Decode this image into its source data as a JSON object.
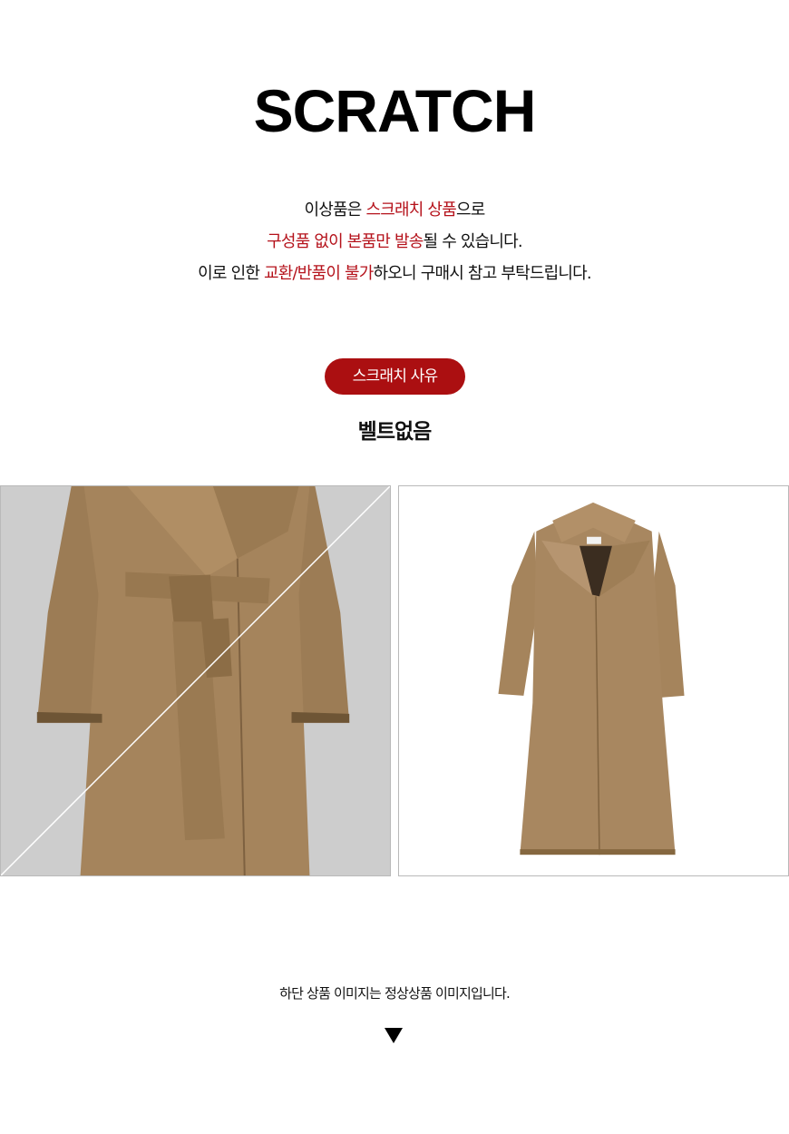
{
  "title": "SCRATCH",
  "notice": {
    "line1": [
      {
        "text": "이상품은 ",
        "highlight": false
      },
      {
        "text": "스크래치 상품",
        "highlight": true
      },
      {
        "text": "으로",
        "highlight": false
      }
    ],
    "line2": [
      {
        "text": "구성품 없이 본품만 발송",
        "highlight": true
      },
      {
        "text": "될 수 있습니다.",
        "highlight": false
      }
    ],
    "line3": [
      {
        "text": "이로 인한 ",
        "highlight": false
      },
      {
        "text": "교환/반품이 불가",
        "highlight": true
      },
      {
        "text": "하오니 구매시 참고 부탁드립니다.",
        "highlight": false
      }
    ]
  },
  "badge": "스크래치 사유",
  "reason": "벨트없음",
  "images": {
    "left": "coat-belt-closeup-crossed-out",
    "right": "coat-full-product"
  },
  "footnote": "하단 상품 이미지는 정상상품 이미지입니다.",
  "arrow_icon": "down-triangle-icon",
  "colors": {
    "accent": "#ab0f11",
    "highlight_text": "#b5121b",
    "coat": "#a5845c",
    "left_bg": "#cdcdcd"
  }
}
